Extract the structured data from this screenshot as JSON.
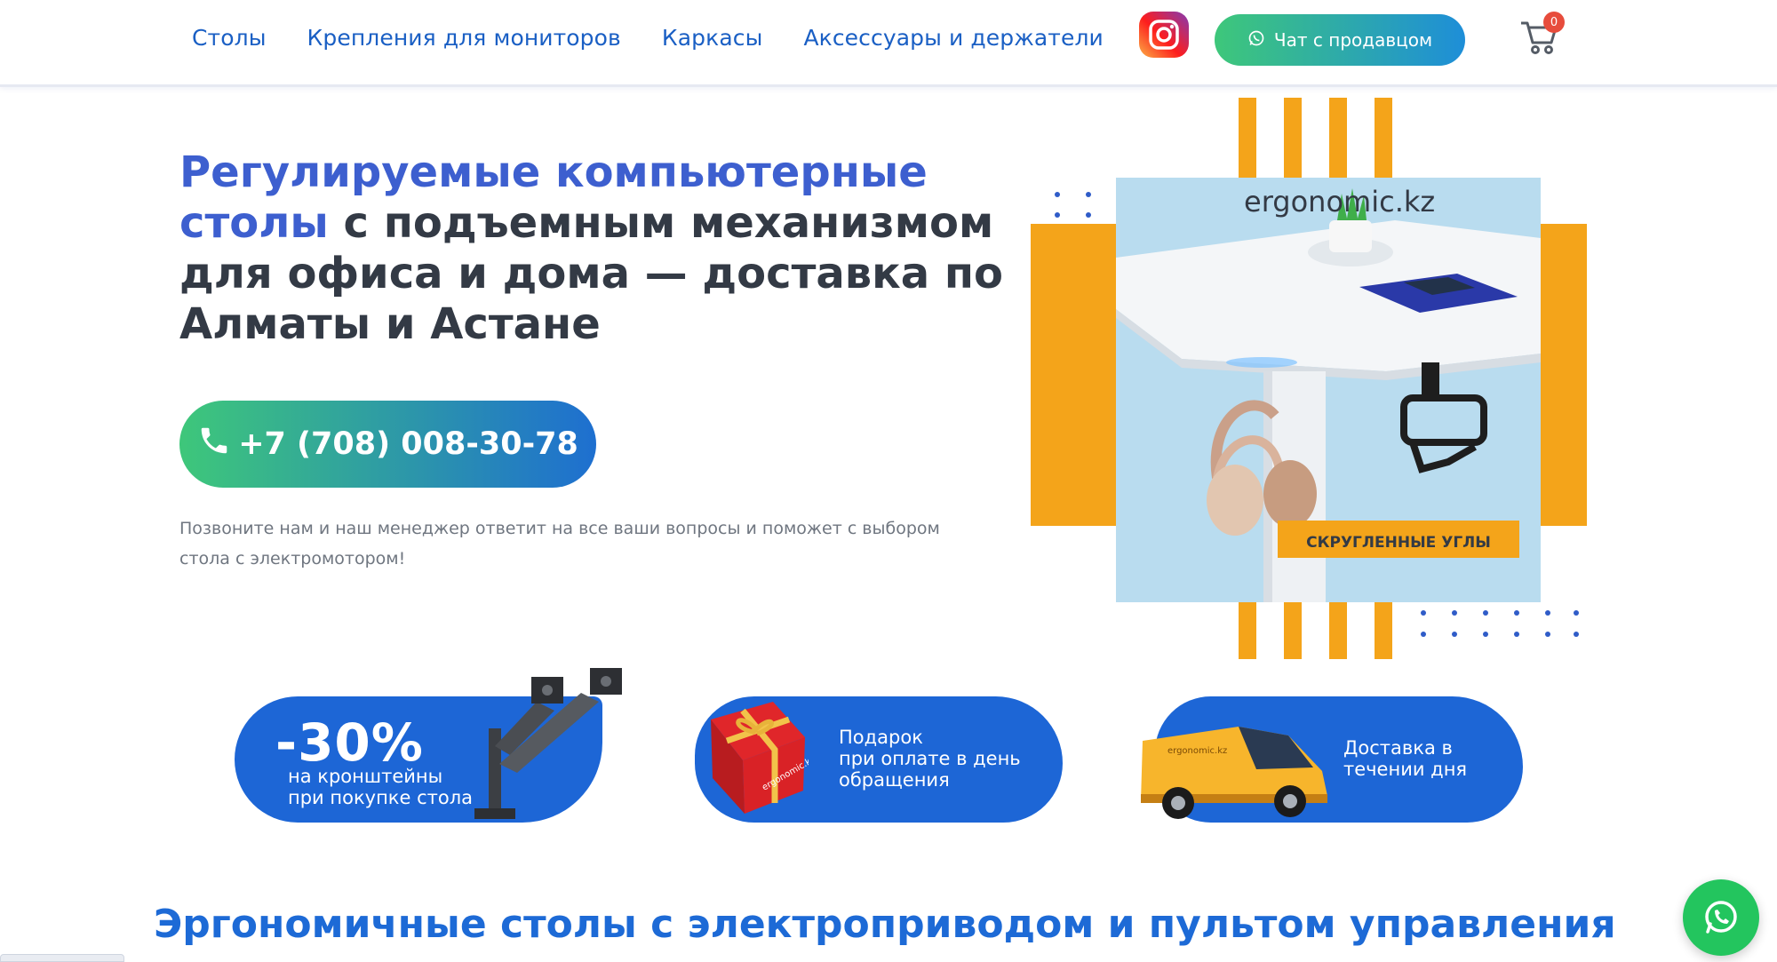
{
  "nav": {
    "items": [
      "Столы",
      "Крепления для мониторов",
      "Каркасы",
      "Аксессуары и держатели"
    ]
  },
  "header": {
    "chat_label": "Чат с продавцом",
    "cart_count": "0"
  },
  "hero": {
    "title_accent": "Регулируемые компьютерные столы",
    "title_rest": " с подъемным механизмом для офиса и дома — доставка по Алматы и Астане",
    "phone": "+7 (708) 008-30-78",
    "subtitle": "Позвоните нам и наш менеджер ответит на все ваши вопросы и поможет с выбором стола с электромотором!",
    "image_brand": "ergonomic.kz",
    "image_banner": "СКРУГЛЕННЫЕ УГЛЫ"
  },
  "promos": [
    {
      "big": "-30%",
      "text_line1": "на кронштейны",
      "text_line2": "при покупке стола"
    },
    {
      "text_line1": "Подарок",
      "text_line2": "при оплате в день",
      "text_line3": "обращения",
      "box_label": "ergonomic.kz"
    },
    {
      "text_line1": "Доставка в",
      "text_line2": "течении дня",
      "van_label": "ergonomic.kz"
    }
  ],
  "section": {
    "heading": "Эргономичные столы с электроприводом и пультом управления"
  },
  "colors": {
    "nav_link": "#1a5fc4",
    "accent_title": "#3d5fcf",
    "promo_blue": "#1d66d6",
    "orange": "#f4a41a",
    "green": "#3ec77a"
  },
  "icons": [
    "instagram-icon",
    "whatsapp-icon",
    "cart-icon",
    "phone-icon"
  ]
}
